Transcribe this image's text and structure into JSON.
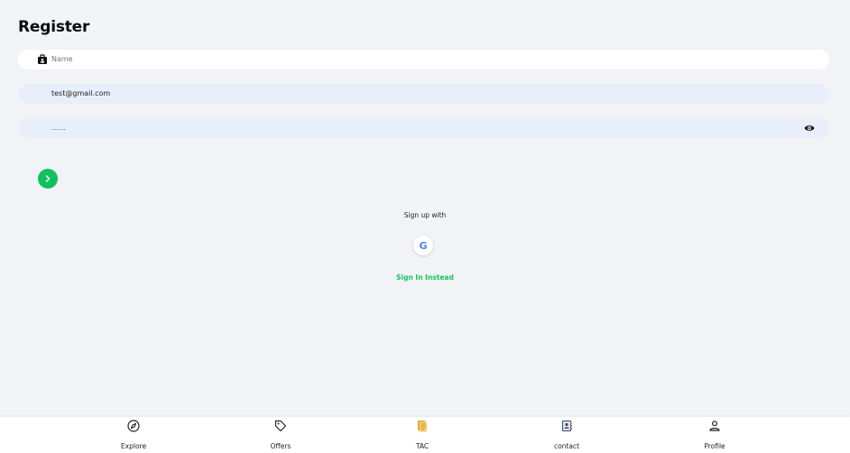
{
  "header": {
    "title": "Register"
  },
  "form": {
    "name": {
      "placeholder": "Name",
      "value": ""
    },
    "email": {
      "value": "test@gmail.com"
    },
    "password": {
      "value": "......"
    }
  },
  "social": {
    "label": "Sign up with",
    "google_letter": "G",
    "signin_link": "Sign In Instead"
  },
  "icons": {
    "name_field": "id-badge-icon",
    "password_toggle": "eye-icon",
    "next": "chevron-right-icon",
    "google": "google-icon"
  },
  "colors": {
    "accent": "#11c15b",
    "link": "#17c35e",
    "field_bg": "#e8effb",
    "page_bg": "#f1f3f7"
  },
  "bottom_nav": {
    "items": [
      {
        "label": "Explore",
        "icon": "compass-icon"
      },
      {
        "label": "Offers",
        "icon": "tag-icon"
      },
      {
        "label": "TAC",
        "icon": "document-icon"
      },
      {
        "label": "contact",
        "icon": "contact-book-icon"
      },
      {
        "label": "Profile",
        "icon": "user-icon"
      }
    ]
  }
}
